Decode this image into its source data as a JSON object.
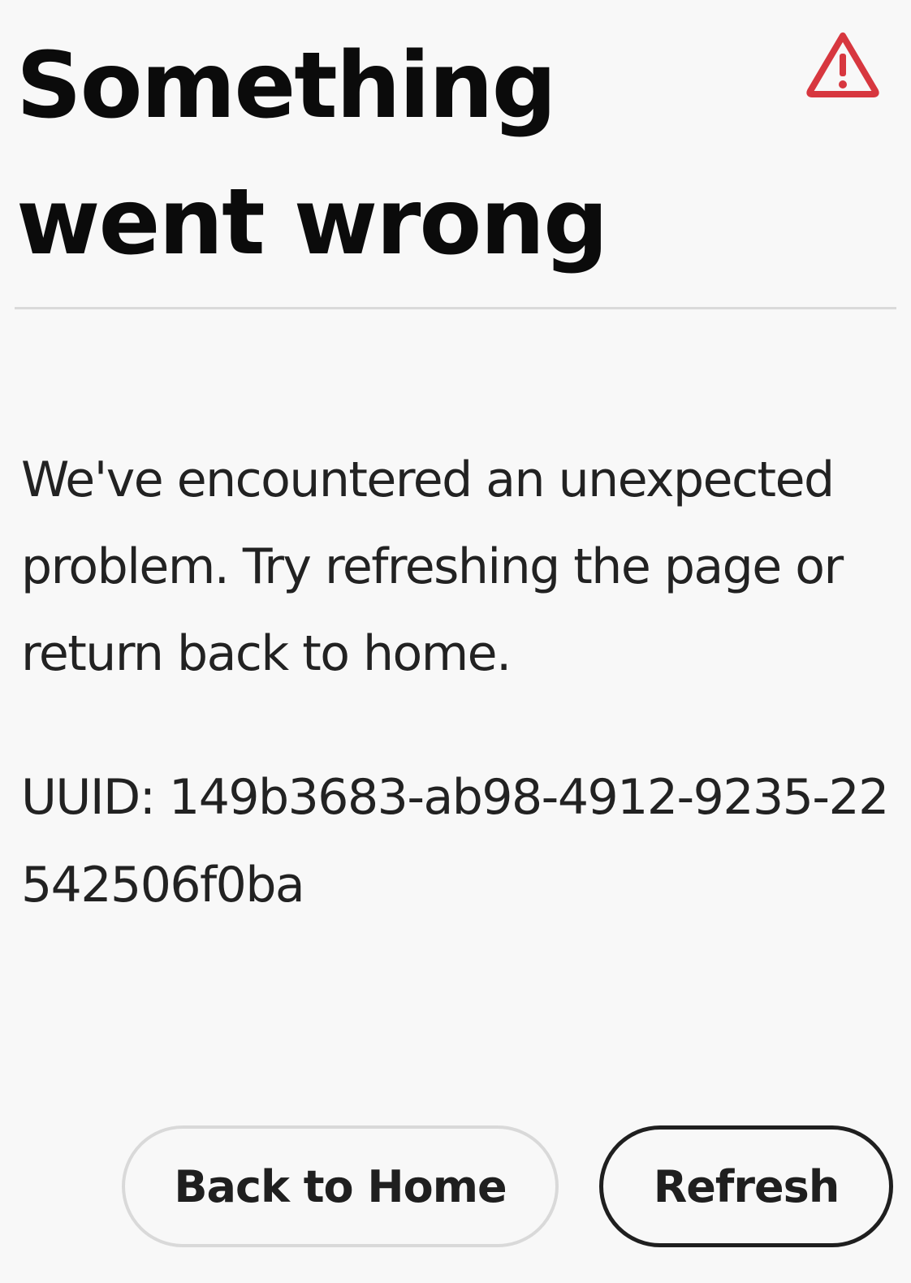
{
  "dialog": {
    "title": "Something went wrong",
    "message": "We've encountered an unexpected problem. Try refreshing the page or return back to home.",
    "uuid_text": "UUID: 149b3683-ab98-4912-9235-22542506f0ba",
    "icon": "alert-triangle-icon",
    "icon_color": "#d7373f"
  },
  "actions": {
    "back_home_label": "Back to Home",
    "refresh_label": "Refresh"
  }
}
